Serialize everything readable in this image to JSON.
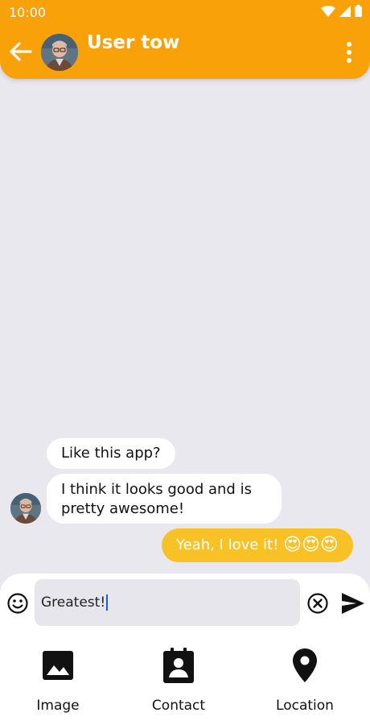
{
  "status_bar": {
    "time": "10:00"
  },
  "header": {
    "title": "User tow",
    "background": "#f8a108"
  },
  "messages": [
    {
      "side": "received",
      "text": "Like this app?"
    },
    {
      "side": "received",
      "text": "I think it looks good and is pretty awesome!"
    },
    {
      "side": "sent",
      "text": "Yeah, I love it! ",
      "emojis": "😍😍😍",
      "color": "#f8c125"
    }
  ],
  "composer": {
    "value": "Greatest!"
  },
  "attachments": [
    {
      "label": "Image",
      "icon": "image-icon"
    },
    {
      "label": "Contact",
      "icon": "contact-icon"
    },
    {
      "label": "Location",
      "icon": "location-pin-icon"
    }
  ]
}
